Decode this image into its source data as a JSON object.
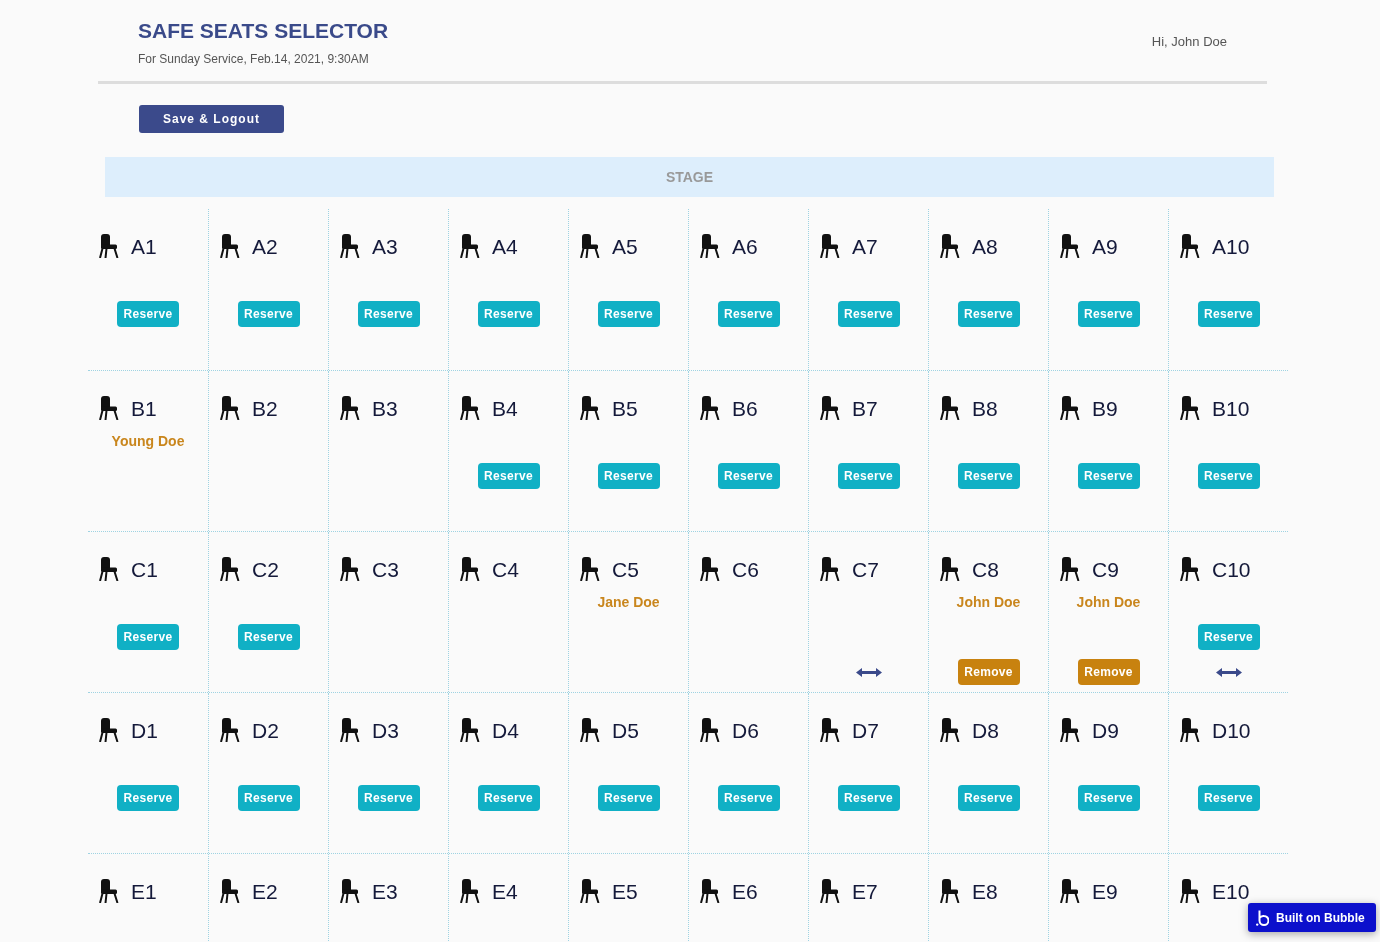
{
  "header": {
    "title": "SAFE SEATS SELECTOR",
    "subtitle": "For Sunday Service, Feb.14, 2021, 9:30AM",
    "greeting": "Hi, John Doe"
  },
  "toolbar": {
    "save_button": "Save & Logout"
  },
  "stage": {
    "label": "STAGE"
  },
  "rows": [
    {
      "seats": [
        {
          "label": "A1",
          "reserve": "Reserve",
          "swap": false
        },
        {
          "label": "A2",
          "reserve": "Reserve",
          "swap": false
        },
        {
          "label": "A3",
          "reserve": "Reserve",
          "swap": false
        },
        {
          "label": "A4",
          "reserve": "Reserve",
          "swap": false
        },
        {
          "label": "A5",
          "reserve": "Reserve",
          "swap": false
        },
        {
          "label": "A6",
          "reserve": "Reserve",
          "swap": false
        },
        {
          "label": "A7",
          "reserve": "Reserve",
          "swap": false
        },
        {
          "label": "A8",
          "reserve": "Reserve",
          "swap": false
        },
        {
          "label": "A9",
          "reserve": "Reserve",
          "swap": false
        },
        {
          "label": "A10",
          "reserve": "Reserve",
          "swap": false
        }
      ]
    },
    {
      "seats": [
        {
          "label": "B1",
          "occupant": "Young Doe",
          "swap": false
        },
        {
          "label": "B2",
          "swap": false
        },
        {
          "label": "B3",
          "swap": false
        },
        {
          "label": "B4",
          "reserve": "Reserve",
          "swap": false
        },
        {
          "label": "B5",
          "reserve": "Reserve",
          "swap": false
        },
        {
          "label": "B6",
          "reserve": "Reserve",
          "swap": false
        },
        {
          "label": "B7",
          "reserve": "Reserve",
          "swap": false
        },
        {
          "label": "B8",
          "reserve": "Reserve",
          "swap": false
        },
        {
          "label": "B9",
          "reserve": "Reserve",
          "swap": false
        },
        {
          "label": "B10",
          "reserve": "Reserve",
          "swap": false
        }
      ]
    },
    {
      "seats": [
        {
          "label": "C1",
          "reserve": "Reserve",
          "swap": false
        },
        {
          "label": "C2",
          "reserve": "Reserve",
          "swap": false
        },
        {
          "label": "C3",
          "swap": false
        },
        {
          "label": "C4",
          "swap": false
        },
        {
          "label": "C5",
          "occupant": "Jane Doe",
          "swap": false
        },
        {
          "label": "C6",
          "swap": false
        },
        {
          "label": "C7",
          "swap": true
        },
        {
          "label": "C8",
          "occupant": "John Doe",
          "remove": "Remove",
          "swap": false
        },
        {
          "label": "C9",
          "occupant": "John Doe",
          "remove": "Remove",
          "swap": false
        },
        {
          "label": "C10",
          "reserve": "Reserve",
          "swap": true
        }
      ]
    },
    {
      "seats": [
        {
          "label": "D1",
          "reserve": "Reserve",
          "swap": false
        },
        {
          "label": "D2",
          "reserve": "Reserve",
          "swap": false
        },
        {
          "label": "D3",
          "reserve": "Reserve",
          "swap": false
        },
        {
          "label": "D4",
          "reserve": "Reserve",
          "swap": false
        },
        {
          "label": "D5",
          "reserve": "Reserve",
          "swap": false
        },
        {
          "label": "D6",
          "reserve": "Reserve",
          "swap": false
        },
        {
          "label": "D7",
          "reserve": "Reserve",
          "swap": false
        },
        {
          "label": "D8",
          "reserve": "Reserve",
          "swap": false
        },
        {
          "label": "D9",
          "reserve": "Reserve",
          "swap": false
        },
        {
          "label": "D10",
          "reserve": "Reserve",
          "swap": false
        }
      ]
    },
    {
      "seats": [
        {
          "label": "E1",
          "swap": false
        },
        {
          "label": "E2",
          "swap": false
        },
        {
          "label": "E3",
          "swap": false
        },
        {
          "label": "E4",
          "swap": false
        },
        {
          "label": "E5",
          "swap": false
        },
        {
          "label": "E6",
          "swap": false
        },
        {
          "label": "E7",
          "swap": false
        },
        {
          "label": "E8",
          "swap": false
        },
        {
          "label": "E9",
          "swap": false
        },
        {
          "label": "E10",
          "swap": false
        }
      ]
    }
  ],
  "badge": {
    "label": "Built on Bubble"
  }
}
